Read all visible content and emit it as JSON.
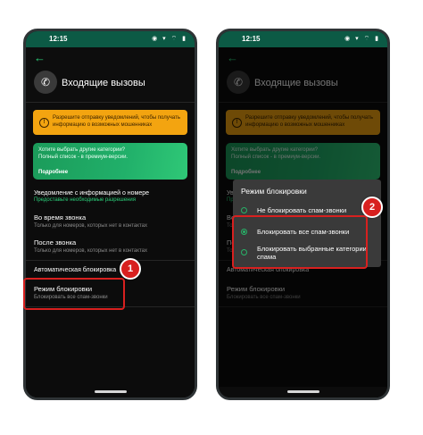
{
  "status_bar": {
    "time": "12:15",
    "icons_text": "◉ ▾ ⌔ ▮"
  },
  "screen": {
    "title": "Входящие вызовы",
    "notification_warning": "Разрешите отправку уведомлений, чтобы получать информацию о возможных мошенниках",
    "promo": {
      "title": "Хотите выбрать другие категории?",
      "subtitle": "Полный список - в премиум-версии.",
      "link": "Подробнее"
    },
    "notify_section": {
      "title": "Уведомление с информацией о номере",
      "subtitle": "Предоставьте необходимые разрешения"
    },
    "during_call": {
      "title": "Во время звонка",
      "subtitle": "Только для номеров, которых нет в контактах"
    },
    "after_call": {
      "title": "После звонка",
      "subtitle": "Только для номеров, которых нет в контактах"
    },
    "auto_block_section": "Автоматическая блокировка",
    "block_mode": {
      "title": "Режим блокировки",
      "subtitle": "Блокировать все спам-звонки"
    }
  },
  "dialog": {
    "title": "Режим блокировки",
    "options": [
      {
        "label": "Не блокировать спам-звонки",
        "selected": false
      },
      {
        "label": "Блокировать все спам-звонки",
        "selected": true
      },
      {
        "label": "Блокировать выбранные категории спама",
        "selected": false
      }
    ]
  },
  "badges": {
    "step1": "1",
    "step2": "2"
  },
  "colors": {
    "accent_green": "#27b368",
    "warning_orange": "#f3a410",
    "highlight_red": "#d8201f",
    "status_bar": "#0c5a45"
  },
  "icons": {
    "back": "back-arrow-icon",
    "phone": "phone-incoming-icon"
  }
}
